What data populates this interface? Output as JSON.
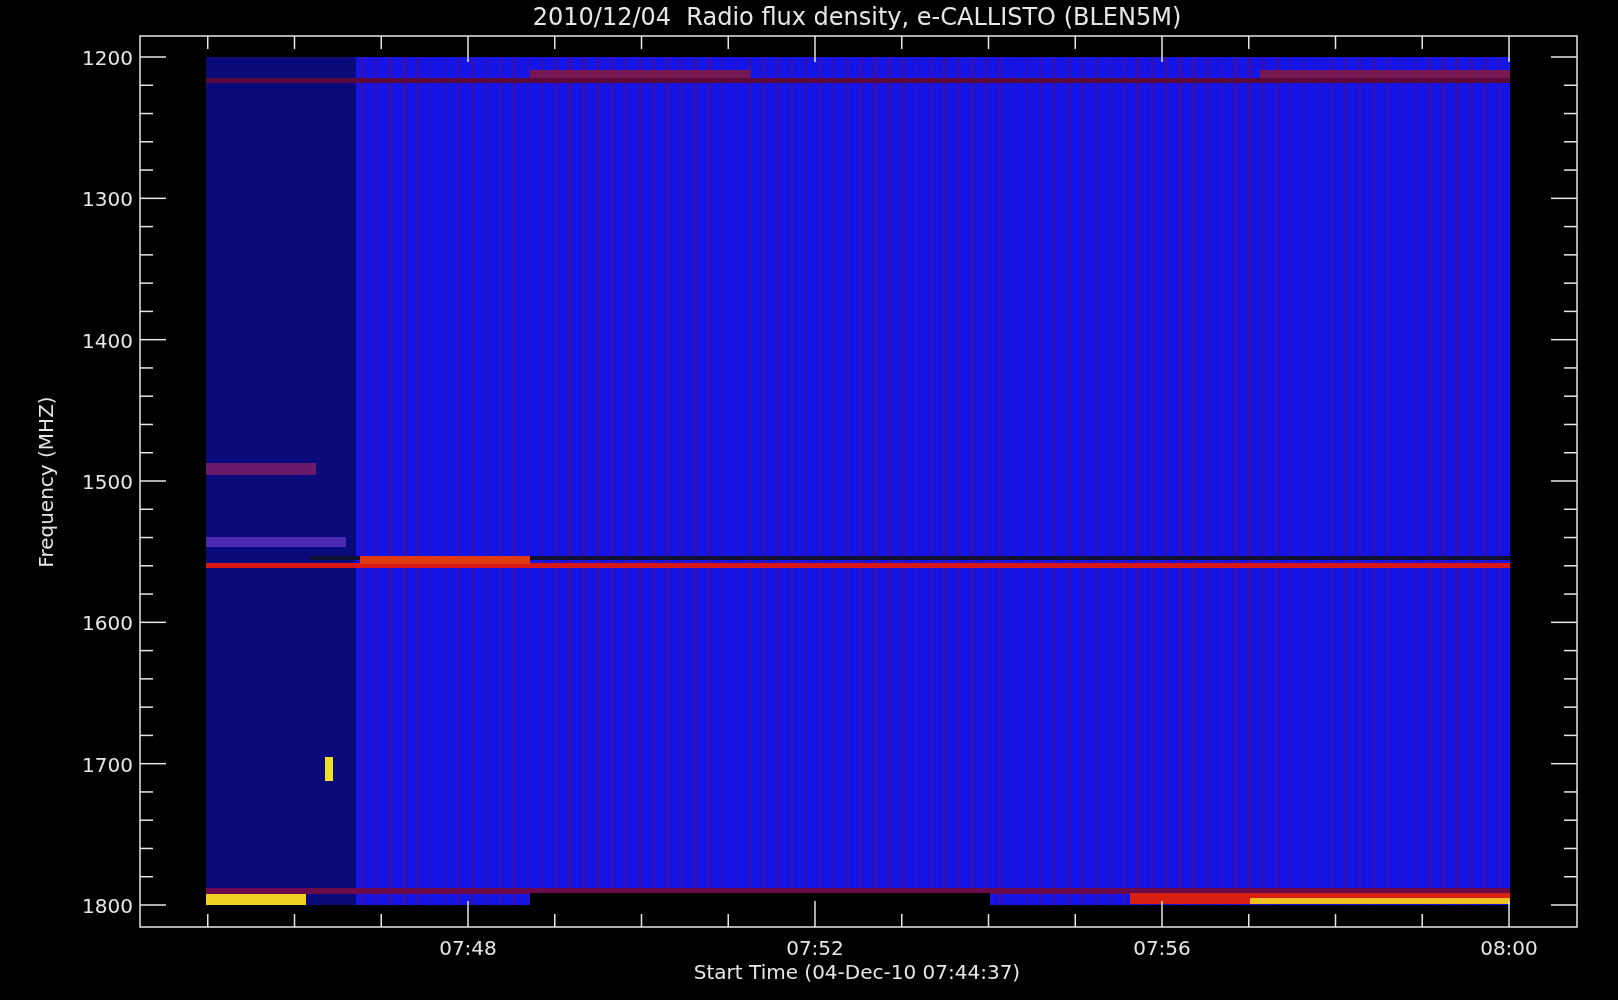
{
  "title": "2010/12/04  Radio flux density, e-CALLISTO (BLEN5M)",
  "y_axis": {
    "label": "Frequency (MHZ)",
    "ticks": [
      "1200",
      "1300",
      "1400",
      "1500",
      "1600",
      "1700",
      "1800"
    ]
  },
  "x_axis": {
    "label": "Start Time (04-Dec-10 07:44:37)",
    "ticks": [
      "07:48",
      "07:52",
      "07:56",
      "08:00"
    ]
  }
}
